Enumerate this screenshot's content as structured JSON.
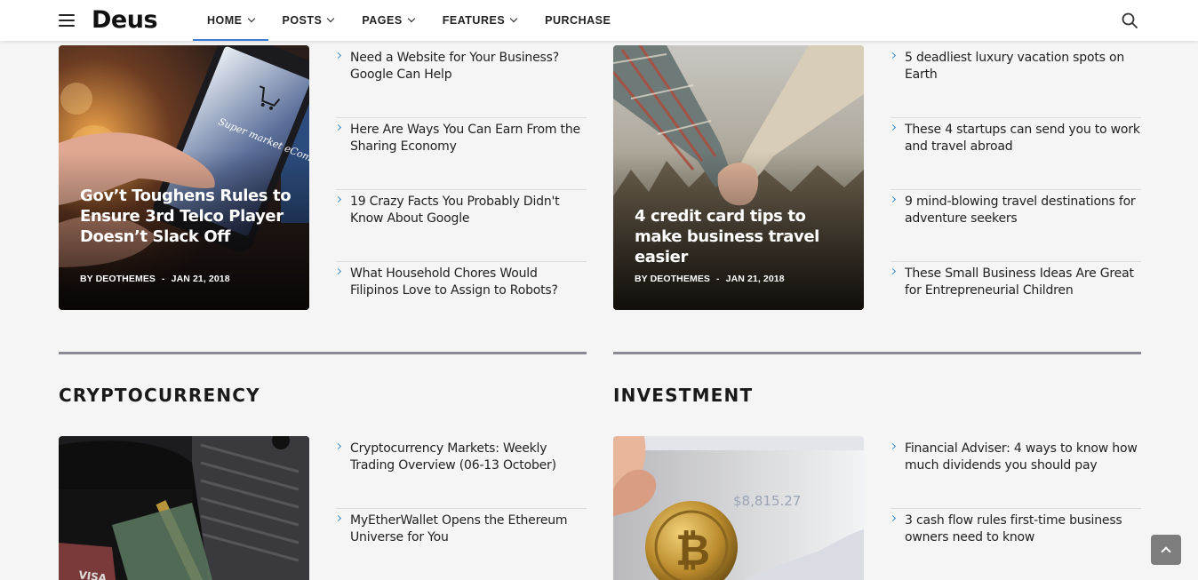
{
  "brand": {
    "logo": "Deus"
  },
  "nav": {
    "menu_icon": "hamburger-menu-icon",
    "search_icon": "search-icon",
    "items": [
      {
        "label": "HOME",
        "dropdown": true,
        "active": true
      },
      {
        "label": "POSTS",
        "dropdown": true
      },
      {
        "label": "PAGES",
        "dropdown": true
      },
      {
        "label": "FEATURES",
        "dropdown": true
      },
      {
        "label": "PURCHASE",
        "dropdown": false
      }
    ]
  },
  "colors": {
    "accent": "#3a7bd5",
    "arrow": "#3a8fd0",
    "rule": "#8a8a93"
  },
  "top_left": {
    "feature": {
      "title": "Gov’t Toughens Rules to Ensure 3rd Telco Player Doesn’t Slack Off",
      "author": "BY DEOTHEMES",
      "date": "JAN 21, 2018"
    },
    "list": [
      "Need a Website for Your Business? Google Can Help",
      "Here Are Ways You Can Earn From the Sharing Economy",
      "19 Crazy Facts You Probably Didn't Know About Google",
      "What Household Chores Would Filipinos Love to Assign to Robots?"
    ]
  },
  "top_right": {
    "feature": {
      "title": "4 credit card tips to make business travel easier",
      "author": "BY DEOTHEMES",
      "date": "JAN 21, 2018"
    },
    "list": [
      "5 deadliest luxury vacation spots on Earth",
      "These 4 startups can send you to work and travel abroad",
      "9 mind-blowing travel destinations for adventure seekers",
      "These Small Business Ideas Are Great for Entrepreneurial Children"
    ]
  },
  "cryptocurrency": {
    "title": "CRYPTOCURRENCY",
    "list": [
      "Cryptocurrency Markets: Weekly Trading Overview (06-13 October)",
      "MyEtherWallet Opens the Ethereum Universe for You"
    ]
  },
  "investment": {
    "title": "INVESTMENT",
    "list": [
      "Financial Adviser: 4 ways to know how much dividends you should pay",
      "3 cash flow rules first-time business owners need to know"
    ]
  },
  "image_text": {
    "phone_screen": "Super market eCommerce Market",
    "price_screen": "$8,815.27",
    "card_brand": "VISA"
  },
  "back_to_top": {
    "icon": "chevron-up-icon"
  }
}
